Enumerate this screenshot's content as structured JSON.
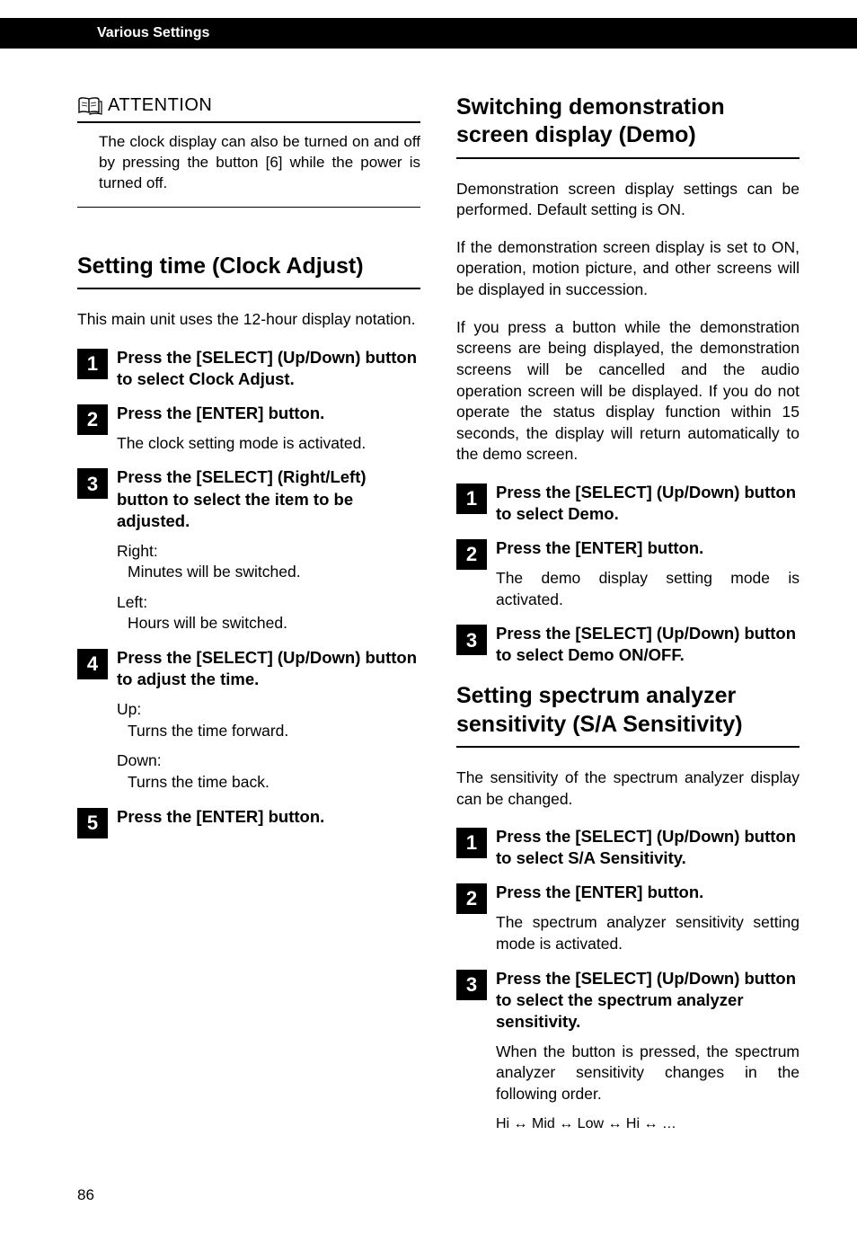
{
  "header": {
    "section": "Various Settings"
  },
  "left": {
    "attention": {
      "title": "ATTENTION",
      "body": "The clock display can also be turned on and off by pressing the button [6] while the power is turned off."
    },
    "clock": {
      "title": "Setting time (Clock Adjust)",
      "intro": "This main unit uses the 12-hour display notation.",
      "steps": [
        {
          "num": "1",
          "heading": "Press the [SELECT] (Up/Down) button to select Clock Adjust."
        },
        {
          "num": "2",
          "heading": "Press the [ENTER] button.",
          "para": "The clock setting mode is activated."
        },
        {
          "num": "3",
          "heading": "Press the [SELECT] (Right/Left) button to select the item to be adjusted.",
          "pairs": [
            {
              "label": "Right:",
              "detail": "Minutes will be switched."
            },
            {
              "label": "Left:",
              "detail": "Hours will be switched."
            }
          ]
        },
        {
          "num": "4",
          "heading": "Press the [SELECT] (Up/Down) button to adjust the time.",
          "pairs": [
            {
              "label": "Up:",
              "detail": "Turns the time forward."
            },
            {
              "label": "Down:",
              "detail": "Turns the time back."
            }
          ]
        },
        {
          "num": "5",
          "heading": "Press the [ENTER] button."
        }
      ]
    }
  },
  "right": {
    "demo": {
      "title": "Switching demonstration screen display (Demo)",
      "intro1": "Demonstration screen display settings can be performed. Default setting is ON.",
      "intro2": "If the demonstration screen display is set to ON, operation, motion picture, and other screens will be displayed in succession.",
      "intro3": "If you press a button while the demonstration screens are being displayed, the demonstration screens will be cancelled and the audio operation screen will be displayed. If you do not operate the status display function within 15 seconds, the display will return automatically to the demo screen.",
      "steps": [
        {
          "num": "1",
          "heading": "Press the [SELECT] (Up/Down) button to select Demo."
        },
        {
          "num": "2",
          "heading": "Press the [ENTER] button.",
          "para": "The demo display setting mode is activated."
        },
        {
          "num": "3",
          "heading": "Press the [SELECT] (Up/Down) button to select Demo ON/OFF."
        }
      ]
    },
    "sa": {
      "title": "Setting spectrum analyzer sensitivity (S/A Sensitivity)",
      "intro": "The sensitivity of the spectrum analyzer display can be changed.",
      "steps": [
        {
          "num": "1",
          "heading": "Press the [SELECT] (Up/Down) button to select S/A Sensitivity."
        },
        {
          "num": "2",
          "heading": "Press the [ENTER] button.",
          "para": "The spectrum analyzer sensitivity setting mode is activated."
        },
        {
          "num": "3",
          "heading": "Press the [SELECT] (Up/Down) button to select the spectrum analyzer sensitivity.",
          "para": "When the button is pressed, the spectrum analyzer sensitivity changes in the following order.",
          "cycle": "Hi ↔ Mid ↔ Low ↔ Hi ↔ …"
        }
      ]
    }
  },
  "pageNumber": "86"
}
